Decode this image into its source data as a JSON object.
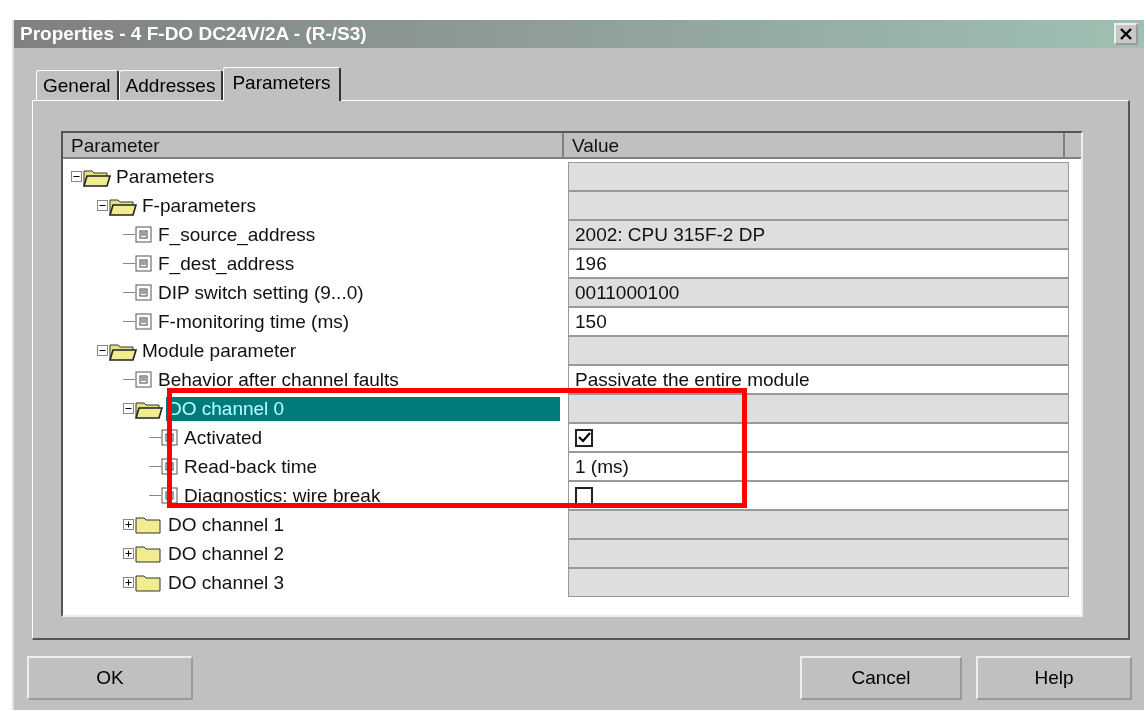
{
  "window": {
    "title": "Properties - 4 F-DO DC24V/2A - (R-/S3)"
  },
  "tabs": [
    {
      "label": "General",
      "selected": false
    },
    {
      "label": "Addresses",
      "selected": false
    },
    {
      "label": "Parameters",
      "selected": true
    }
  ],
  "table": {
    "columns": [
      "Parameter",
      "Value"
    ],
    "rows": [
      {
        "label": "Parameters",
        "kind": "folder",
        "expanded": true,
        "selected": false,
        "highlighted": false,
        "children": [
          {
            "label": "F-parameters",
            "kind": "folder",
            "expanded": true,
            "selected": false,
            "highlighted": false,
            "children": [
              {
                "label": "F_source_address",
                "kind": "text",
                "selected": false,
                "highlighted": false,
                "value": "2002: CPU 315F-2 DP",
                "editable": false
              },
              {
                "label": "F_dest_address",
                "kind": "text",
                "selected": false,
                "highlighted": false,
                "value": "196",
                "editable": true
              },
              {
                "label": "DIP switch setting (9...0)",
                "kind": "text",
                "selected": false,
                "highlighted": false,
                "value": "0011000100",
                "editable": false
              },
              {
                "label": "F-monitoring time (ms)",
                "kind": "text",
                "selected": false,
                "highlighted": false,
                "value": "150",
                "editable": true
              }
            ]
          },
          {
            "label": "Module parameter",
            "kind": "folder",
            "expanded": true,
            "selected": false,
            "highlighted": false,
            "children": [
              {
                "label": "Behavior after channel faults",
                "kind": "text",
                "selected": false,
                "highlighted": false,
                "value": "Passivate the entire module",
                "editable": true
              },
              {
                "label": "DO channel 0",
                "kind": "folder",
                "expanded": true,
                "selected": true,
                "highlighted": true,
                "children": [
                  {
                    "label": "Activated",
                    "kind": "checkbox",
                    "selected": false,
                    "highlighted": false,
                    "checked": true,
                    "editable": true
                  },
                  {
                    "label": "Read-back time",
                    "kind": "text",
                    "selected": false,
                    "highlighted": false,
                    "value": "1 (ms)",
                    "editable": true
                  },
                  {
                    "label": "Diagnostics: wire break",
                    "kind": "checkbox",
                    "selected": false,
                    "highlighted": false,
                    "checked": false,
                    "editable": true
                  }
                ]
              },
              {
                "label": "DO channel 1",
                "kind": "folder",
                "expanded": false,
                "selected": false,
                "highlighted": false
              },
              {
                "label": "DO channel 2",
                "kind": "folder",
                "expanded": false,
                "selected": false,
                "highlighted": false
              },
              {
                "label": "DO channel 3",
                "kind": "folder",
                "expanded": false,
                "selected": false,
                "highlighted": false
              }
            ]
          }
        ]
      }
    ]
  },
  "buttons": [
    {
      "label": "OK"
    },
    {
      "label": "Cancel"
    },
    {
      "label": "Help"
    }
  ]
}
